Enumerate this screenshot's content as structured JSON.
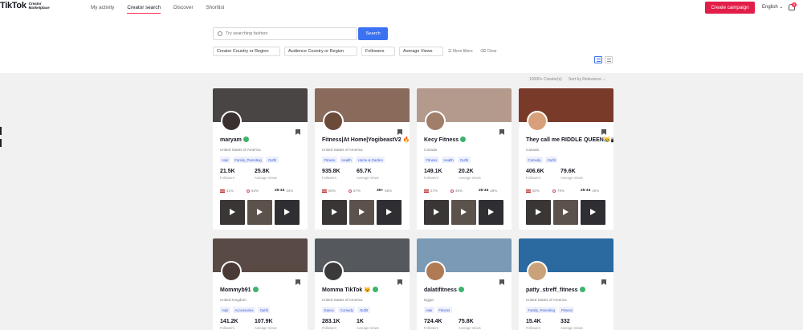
{
  "header": {
    "logo_main": "TikTok",
    "logo_sub": "Creator Marketplace",
    "nav": [
      "My activity",
      "Creator search",
      "Discover",
      "Shortlist"
    ],
    "create_campaign": "Create campaign",
    "language": "English ⌄",
    "notification_count": "8"
  },
  "search": {
    "placeholder": "Try searching fashion",
    "button": "Search",
    "filters": [
      "Creator Country or Region",
      "Audience Country or Region",
      "Followers",
      "Average Views"
    ],
    "more_filters": "More filters",
    "clear": "Clear"
  },
  "results": {
    "count": "10000+ Creator(s)",
    "sort": "Sort by Relevance ⌄"
  },
  "labels": {
    "followers": "Followers",
    "average_views": "Average Views"
  },
  "colors": {
    "accent": "#fe2c55",
    "primary_button": "#e11d48",
    "search_button": "#3b72f2"
  },
  "creators": [
    {
      "name": "maryam",
      "country": "United States of America",
      "tags": [
        "Hair",
        "Family_Parenting",
        "Outfit"
      ],
      "followers": "21.5K",
      "views": "25.8K",
      "demo_country_pct": "41%",
      "female_pct": "63%",
      "age": "25-34",
      "age_pct": "34%",
      "cover": "#4a4545",
      "avatar": "#3a3030"
    },
    {
      "name": "Fitness|At Home|YogibeastV2 🔥",
      "country": "United States of America",
      "tags": [
        "Fitness",
        "Health",
        "Home & Garden"
      ],
      "followers": "935.8K",
      "views": "65.7K",
      "demo_country_pct": "80%",
      "female_pct": "67%",
      "age": "35+",
      "age_pct": "65%",
      "cover": "#8a6a5a",
      "avatar": "#6b4a3a"
    },
    {
      "name": "Kecy Fitness",
      "country": "Canada",
      "tags": [
        "Fitness",
        "Health",
        "Outfit"
      ],
      "followers": "149.1K",
      "views": "20.2K",
      "demo_country_pct": "27%",
      "female_pct": "45%",
      "age": "25-34",
      "age_pct": "28%",
      "cover": "#b49a8c",
      "avatar": "#a07e6a"
    },
    {
      "name": "They call me RIDDLE QUEEN😹📷",
      "country": "Canada",
      "tags": [
        "Comedy",
        "Outfit"
      ],
      "followers": "406.6K",
      "views": "79.6K",
      "demo_country_pct": "50%",
      "female_pct": "79%",
      "age": "25-34",
      "age_pct": "40%",
      "cover": "#7a3a2a",
      "avatar": "#d7a07a"
    },
    {
      "name": "Mommyb91",
      "country": "United Kingdom",
      "tags": [
        "Hair",
        "Accessories",
        "Outfit"
      ],
      "followers": "141.2K",
      "views": "107.9K",
      "cover": "#5a4a45",
      "avatar": "#4a3a35"
    },
    {
      "name": "Momma TikTok 😼",
      "country": "United States of America",
      "tags": [
        "Dance",
        "Comedy",
        "Outfit"
      ],
      "followers": "283.1K",
      "views": "1K",
      "cover": "#55585c",
      "avatar": "#3a3a3a"
    },
    {
      "name": "dalatifitness",
      "country": "Egypt",
      "tags": [
        "Hair",
        "Fitness"
      ],
      "followers": "724.4K",
      "views": "75.8K",
      "cover": "#7a9ab5",
      "avatar": "#b07a55"
    },
    {
      "name": "patty_streff_fitness",
      "country": "United States of America",
      "tags": [
        "Family_Parenting",
        "Fitness"
      ],
      "followers": "15.4K",
      "views": "332",
      "cover": "#2a6aa0",
      "avatar": "#c9a27a"
    }
  ]
}
